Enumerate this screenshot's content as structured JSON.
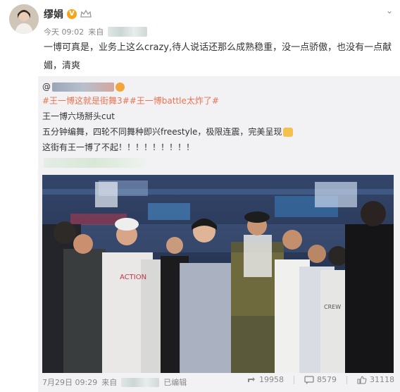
{
  "author": {
    "name": "缪娟",
    "verified_badge": "V"
  },
  "post": {
    "time": "今天 09:02",
    "from": "来自",
    "text": "一博可真是，业务上这么crazy,待人说话还那么成熟稳重，没一点骄傲，也没有一点献媚，清爽"
  },
  "repost": {
    "at": "@",
    "hashtag1": "#王一博这就是街舞3#",
    "hashtag2": "#王一博battle太炸了#",
    "line2": "王一博六场掰头cut",
    "line3": "五分钟编舞，四轮不同舞种即兴freestyle，极限连震，完美呈现",
    "line4": "这街有王一博了不起！！！！！！！！！",
    "video_label": "ACTION",
    "video_label2": "CREW",
    "footer_date": "7月29日 09:29",
    "footer_from": "来自",
    "footer_edited": "已编辑",
    "reposts": "19958",
    "comments": "8579",
    "likes": "31118"
  },
  "colors": {
    "hashtag": "#eb7350",
    "badge": "#f7a41b"
  },
  "icons": [
    "chevron-down-icon",
    "repost-icon",
    "comment-icon",
    "like-icon",
    "thumbs-up-emoji"
  ]
}
